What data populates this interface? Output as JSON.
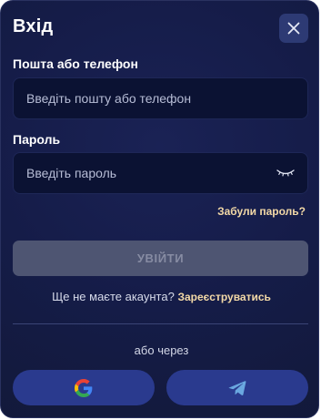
{
  "modal": {
    "title": "Вхід",
    "close_icon": "close-icon"
  },
  "login_field": {
    "label": "Пошта або телефон",
    "placeholder": "Введіть пошту або телефон",
    "value": ""
  },
  "password_field": {
    "label": "Пароль",
    "placeholder": "Введіть пароль",
    "value": "",
    "toggle_icon": "eye-closed-icon"
  },
  "forgot_password": "Забули пароль?",
  "submit": {
    "label": "УВІЙТИ",
    "disabled": true
  },
  "signup": {
    "question": "Ще не маєте акаунта?",
    "link": "Зареєструватись"
  },
  "alt_login": {
    "text": "або через",
    "providers": [
      {
        "name": "Google",
        "icon": "google-icon"
      },
      {
        "name": "Telegram",
        "icon": "telegram-icon"
      }
    ]
  },
  "colors": {
    "background": "#151c48",
    "input_bg": "#0b1233",
    "accent_link": "#f3d9a7",
    "button_disabled": "#4e5572",
    "social_button": "#2a3a8e",
    "close_button": "#2d3a74"
  }
}
